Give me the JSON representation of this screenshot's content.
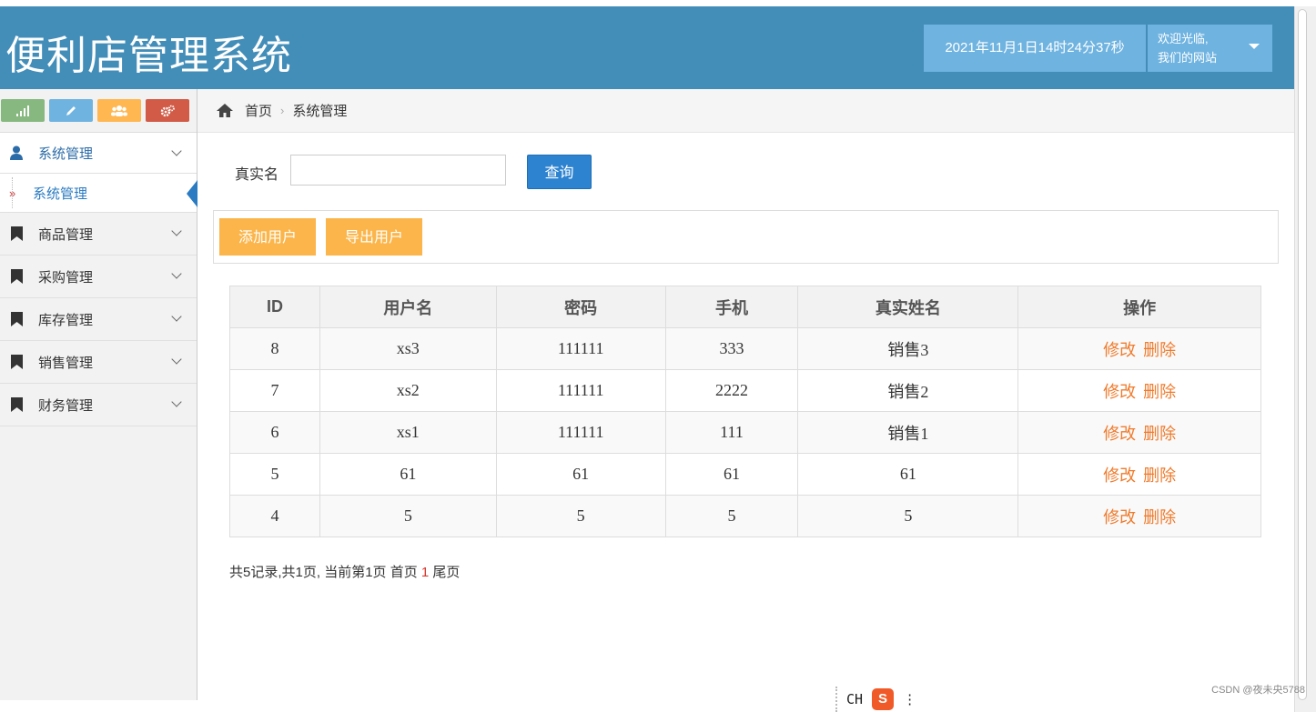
{
  "header": {
    "title": "便利店管理系统",
    "datetime": "2021年11月1日14时24分37秒",
    "welcome_line1": "欢迎光临,",
    "welcome_line2": "我们的网站"
  },
  "shortcuts": [
    {
      "icon": "signal-icon",
      "color": "#87b87f"
    },
    {
      "icon": "pencil-icon",
      "color": "#6fb3e0"
    },
    {
      "icon": "users-icon",
      "color": "#ffb752"
    },
    {
      "icon": "cogs-icon",
      "color": "#d15b47"
    }
  ],
  "sidebar": {
    "items": [
      {
        "label": "系统管理",
        "icon": "user-icon",
        "open": true
      },
      {
        "label": "系统管理",
        "sub": true,
        "active": true
      },
      {
        "label": "商品管理",
        "icon": "bookmark-icon"
      },
      {
        "label": "采购管理",
        "icon": "bookmark-icon"
      },
      {
        "label": "库存管理",
        "icon": "bookmark-icon"
      },
      {
        "label": "销售管理",
        "icon": "bookmark-icon"
      },
      {
        "label": "财务管理",
        "icon": "bookmark-icon"
      }
    ]
  },
  "breadcrumb": {
    "home": "首页",
    "current": "系统管理"
  },
  "search": {
    "label": "真实名",
    "value": "",
    "button": "查询"
  },
  "actions": {
    "add": "添加用户",
    "export": "导出用户"
  },
  "table": {
    "headers": [
      "ID",
      "用户名",
      "密码",
      "手机",
      "真实姓名",
      "操作"
    ],
    "rows": [
      [
        "8",
        "xs3",
        "111111",
        "333",
        "销售3"
      ],
      [
        "7",
        "xs2",
        "111111",
        "2222",
        "销售2"
      ],
      [
        "6",
        "xs1",
        "111111",
        "111",
        "销售1"
      ],
      [
        "5",
        "61",
        "61",
        "61",
        "61"
      ],
      [
        "4",
        "5",
        "5",
        "5",
        "5"
      ]
    ],
    "edit_label": "修改",
    "delete_label": "删除"
  },
  "pager": {
    "summary": "共5记录,共1页, 当前第1页",
    "first": "首页",
    "current": "1",
    "last": "尾页"
  },
  "ime": {
    "lang": "CH",
    "logo": "S"
  },
  "watermark": "CSDN @夜未央5788"
}
